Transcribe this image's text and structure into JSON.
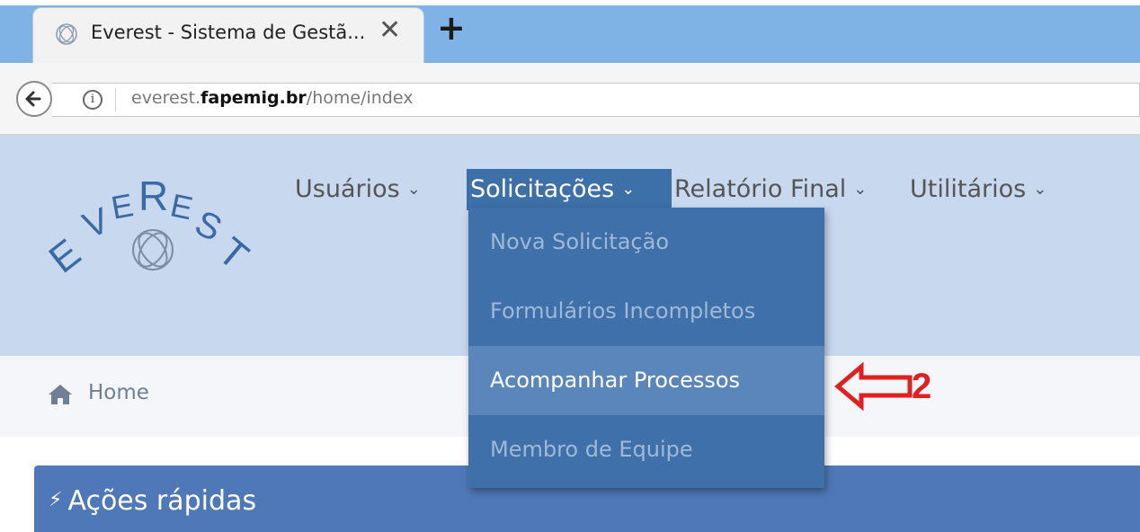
{
  "browser": {
    "tab_title": "Everest - Sistema de Gestã...",
    "tab_close": "✕",
    "new_tab": "+",
    "url_prefix": "everest.",
    "url_domain": "fapemig.br",
    "url_path": "/home/index"
  },
  "nav": {
    "items": [
      {
        "label": "Usuários"
      },
      {
        "label": "Solicitações"
      },
      {
        "label": "Relatório Final"
      },
      {
        "label": "Utilitários"
      }
    ],
    "chevron": "⌄",
    "dropdown": [
      {
        "label": "Nova Solicitação"
      },
      {
        "label": "Formulários Incompletos"
      },
      {
        "label": "Acompanhar Processos"
      },
      {
        "label": "Membro de Equipe"
      }
    ]
  },
  "logo": {
    "text": "EVEREST"
  },
  "breadcrumb": {
    "home": "Home"
  },
  "quick_actions": {
    "title": "Ações rápidas",
    "icon": "⚡"
  },
  "annotation": {
    "number": "2"
  },
  "colors": {
    "header_bg": "#c7d8ef",
    "menu_bg": "#3f70aa",
    "menu_hover": "#5a86bb",
    "panel_bg": "#4f78b8",
    "annotation": "#e02020"
  }
}
